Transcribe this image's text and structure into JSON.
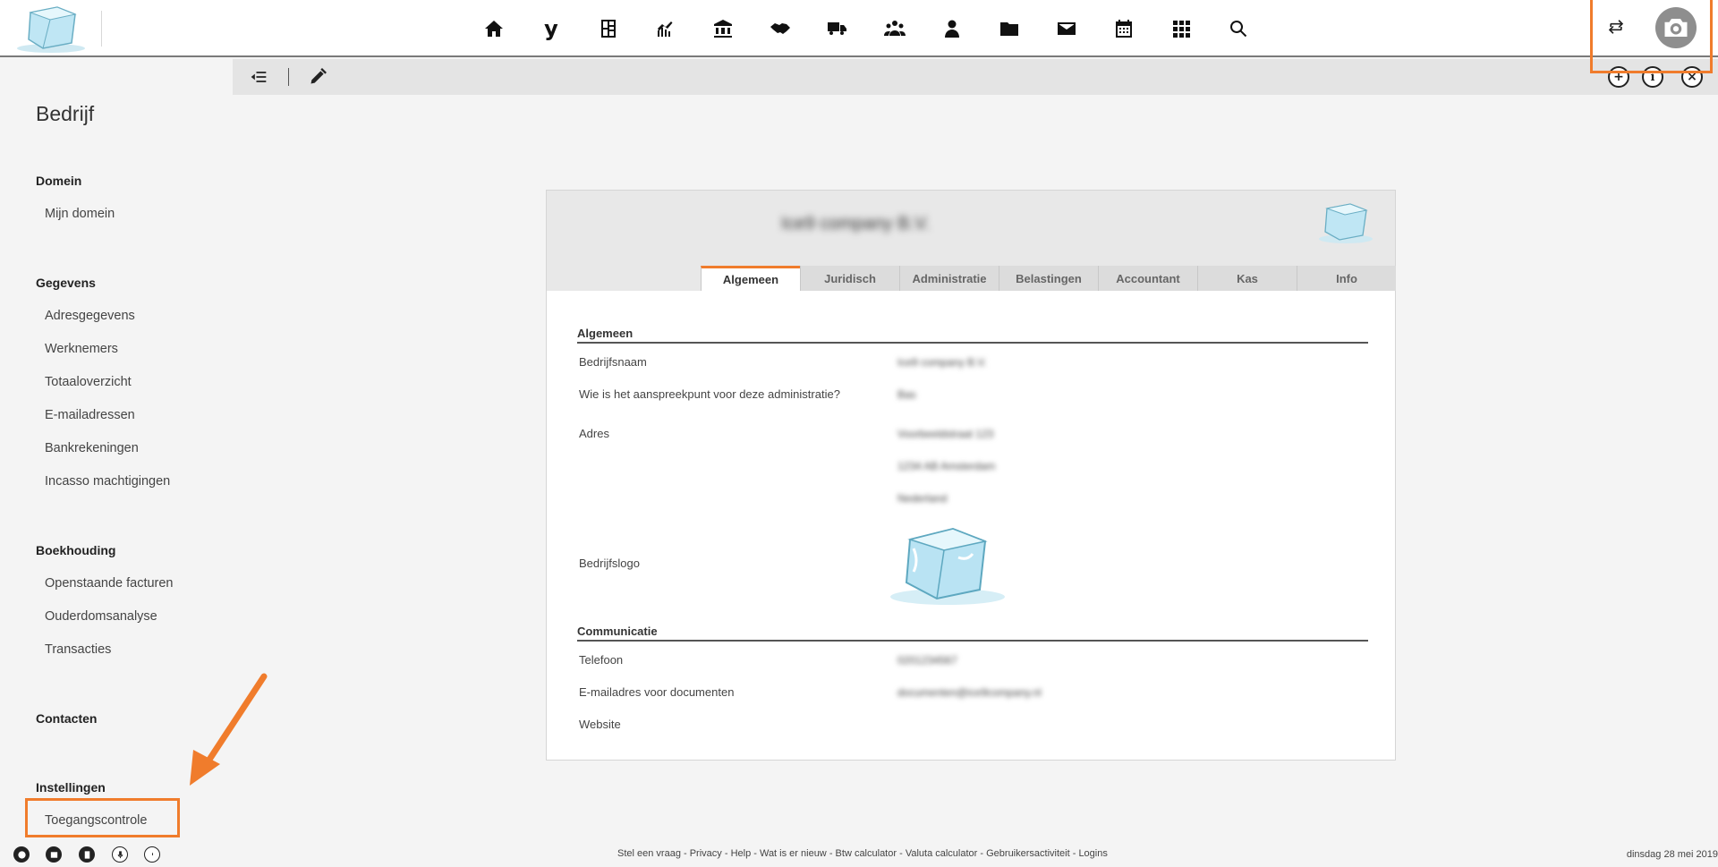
{
  "page_title": "Bedrijf",
  "nav_icons": [
    "home-icon",
    "y-brand-icon",
    "calculator-icon",
    "trending-chart-icon",
    "bank-icon",
    "handshake-icon",
    "truck-icon",
    "group-icon",
    "person-icon",
    "folder-icon",
    "mail-icon",
    "calendar-icon",
    "grid-apps-icon",
    "search-icon"
  ],
  "nav_y_label": "y",
  "toolbar": {
    "collapse_icon": "outdent-icon",
    "edit_icon": "pencil-icon",
    "add": "+",
    "info": "i",
    "close": "×"
  },
  "sidebar": {
    "sections": [
      {
        "heading": "Domein",
        "items": [
          "Mijn domein"
        ]
      },
      {
        "heading": "Gegevens",
        "items": [
          "Adresgegevens",
          "Werknemers",
          "Totaaloverzicht",
          "E-mailadressen",
          "Bankrekeningen",
          "Incasso machtigingen"
        ]
      },
      {
        "heading": "Boekhouding",
        "items": [
          "Openstaande facturen",
          "Ouderdomsanalyse",
          "Transacties"
        ]
      },
      {
        "heading": "Contacten",
        "items": []
      },
      {
        "heading": "Instellingen",
        "items": [
          "Toegangscontrole"
        ]
      }
    ]
  },
  "card": {
    "company_name": "Ice9 company B.V.",
    "tabs": [
      "Algemeen",
      "Juridisch",
      "Administratie",
      "Belastingen",
      "Accountant",
      "Kas",
      "Info"
    ],
    "active_tab": "Algemeen",
    "section_general": "Algemeen",
    "label_company_name": "Bedrijfsnaam",
    "value_company_name": "Ice9 company B.V.",
    "label_contact": "Wie is het aanspreekpunt voor deze administratie?",
    "value_contact": "Bas",
    "label_address": "Adres",
    "address_lines": [
      "Voorbeeldstraat 123",
      "1234 AB Amsterdam",
      "Nederland"
    ],
    "label_logo": "Bedrijfslogo",
    "section_comm": "Communicatie",
    "label_phone": "Telefoon",
    "value_phone": "0201234567",
    "label_email_docs": "E-mailadres voor documenten",
    "value_email_docs": "documenten@ice9company.nl",
    "label_website": "Website"
  },
  "footer": {
    "links": [
      "Stel een vraag",
      "Privacy",
      "Help",
      "Wat is er nieuw",
      "Btw calculator",
      "Valuta calculator",
      "Gebruikersactiviteit",
      "Logins"
    ],
    "date": "dinsdag 28 mei 2019",
    "icons": [
      "globe-icon",
      "window-icon",
      "clipboard-icon",
      "microphone-icon",
      "timer-icon"
    ]
  },
  "colors": {
    "accent": "#f07c2c",
    "toolbar_bg": "#e4e4e4",
    "page_bg": "#f4f4f4"
  }
}
